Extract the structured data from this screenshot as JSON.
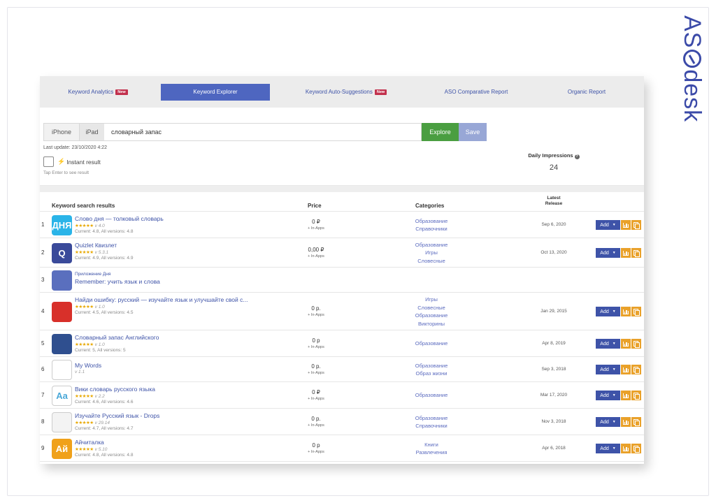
{
  "brand": {
    "prefix": "AS",
    "suffix": "desk"
  },
  "tabs": [
    {
      "label": "Keyword Analytics",
      "badge": "New"
    },
    {
      "label": "Keyword Explorer",
      "badge": ""
    },
    {
      "label": "Keyword Auto-Suggestions",
      "badge": "New"
    },
    {
      "label": "ASO Comparative Report",
      "badge": ""
    },
    {
      "label": "Organic Report",
      "badge": ""
    }
  ],
  "colors": {
    "accent": "#4e66c0",
    "explore": "#4a9e41",
    "save": "#98a7d6",
    "action": "#e9a12a",
    "add": "#3e53a8"
  },
  "search": {
    "devices": [
      "iPhone",
      "iPad"
    ],
    "value": "словарный запас",
    "explore_label": "Explore",
    "save_label": "Save",
    "last_update": "Last update: 23/10/2020 4:22",
    "instant_label": "Instant result",
    "tap_hint": "Tap Enter to see result",
    "impressions_label": "Daily Impressions",
    "impressions_value": "24"
  },
  "table": {
    "headers": {
      "keyword": "Keyword search results",
      "price": "Price",
      "categories": "Categories",
      "release": "Latest Release"
    },
    "add_label": "Add",
    "rows": [
      {
        "rank": "1",
        "name": "Слово дня — толковый словарь",
        "developer": "",
        "stars": "★★★★★",
        "version": "v 4.0",
        "versions": "Current: 4.8, All versions: 4.8",
        "price": "0 ₽",
        "inapps": "+ In-Apps",
        "categories": [
          "Образование",
          "Справочники"
        ],
        "release": "Sep 6, 2020",
        "icon_text": "ДНЯ",
        "icon_color": "#2ab4e8"
      },
      {
        "rank": "2",
        "name": "Quizlet Квизлет",
        "developer": "",
        "stars": "★★★★★",
        "version": "v 5.3.1",
        "versions": "Current: 4.9, All versions: 4.9",
        "price": "0,00 ₽",
        "inapps": "+ In-Apps",
        "categories": [
          "Образование",
          "Игры",
          "Словесные"
        ],
        "release": "Oct 13, 2020",
        "icon_text": "Q",
        "icon_color": "#3a4a9a"
      },
      {
        "rank": "3",
        "name": "Remember: учить язык и слова",
        "developer": "Приложение Дня",
        "stars": "",
        "version": "",
        "versions": "",
        "price": "",
        "inapps": "",
        "categories": [],
        "release": "",
        "icon_text": "",
        "icon_color": "#5a6fbe"
      },
      {
        "rank": "4",
        "name": "Найди ошибку: русский — изучайте язык и улучшайте свой с...",
        "developer": "",
        "stars": "★★★★★",
        "version": "v 1.0",
        "versions": "Current: 4.5, All versions: 4.5",
        "price": "0 р.",
        "inapps": "+ In-Apps",
        "categories": [
          "Игры",
          "Словесные",
          "Образование",
          "Викторины"
        ],
        "release": "Jan 29, 2015",
        "icon_text": "",
        "icon_color": "#d8302a"
      },
      {
        "rank": "5",
        "name": "Словарный запас Английского",
        "developer": "",
        "stars": "★★★★★",
        "version": "v 1.0",
        "versions": "Current: 5, All versions: 5",
        "price": "0 р",
        "inapps": "+ In-Apps",
        "categories": [
          "Образование"
        ],
        "release": "Apr 8, 2019",
        "icon_text": "",
        "icon_color": "#2f4f8f"
      },
      {
        "rank": "6",
        "name": "My Words",
        "developer": "",
        "stars": "",
        "version": "v 1.1",
        "versions": "",
        "price": "0 р.",
        "inapps": "+ In-Apps",
        "categories": [
          "Образование",
          "Образ жизни"
        ],
        "release": "Sep 3, 2018",
        "icon_text": "",
        "icon_color": "#ffffff"
      },
      {
        "rank": "7",
        "name": "Вики словарь русского языка",
        "developer": "",
        "stars": "★★★★★",
        "version": "v 2.2",
        "versions": "Current: 4.6, All versions: 4.6",
        "price": "0 ₽",
        "inapps": "+ In-Apps",
        "categories": [
          "Образование"
        ],
        "release": "Mar 17, 2020",
        "icon_text": "Aa",
        "icon_color": "#ffffff"
      },
      {
        "rank": "8",
        "name": "Изучайте Русский язык - Drops",
        "developer": "",
        "stars": "★★★★★",
        "version": "v 29.14",
        "versions": "Current: 4.7, All versions: 4.7",
        "price": "0 р.",
        "inapps": "+ In-Apps",
        "categories": [
          "Образование",
          "Справочники"
        ],
        "release": "Nov 3, 2018",
        "icon_text": "",
        "icon_color": "#f3f3f3"
      },
      {
        "rank": "9",
        "name": "Айчиталка",
        "developer": "",
        "stars": "★★★★★",
        "version": "v 5.10",
        "versions": "Current: 4.8, All versions: 4.8",
        "price": "0 р",
        "inapps": "+ In-Apps",
        "categories": [
          "Книги",
          "Развлечения"
        ],
        "release": "Apr 6, 2018",
        "icon_text": "Ай",
        "icon_color": "#f0a11a"
      }
    ]
  }
}
